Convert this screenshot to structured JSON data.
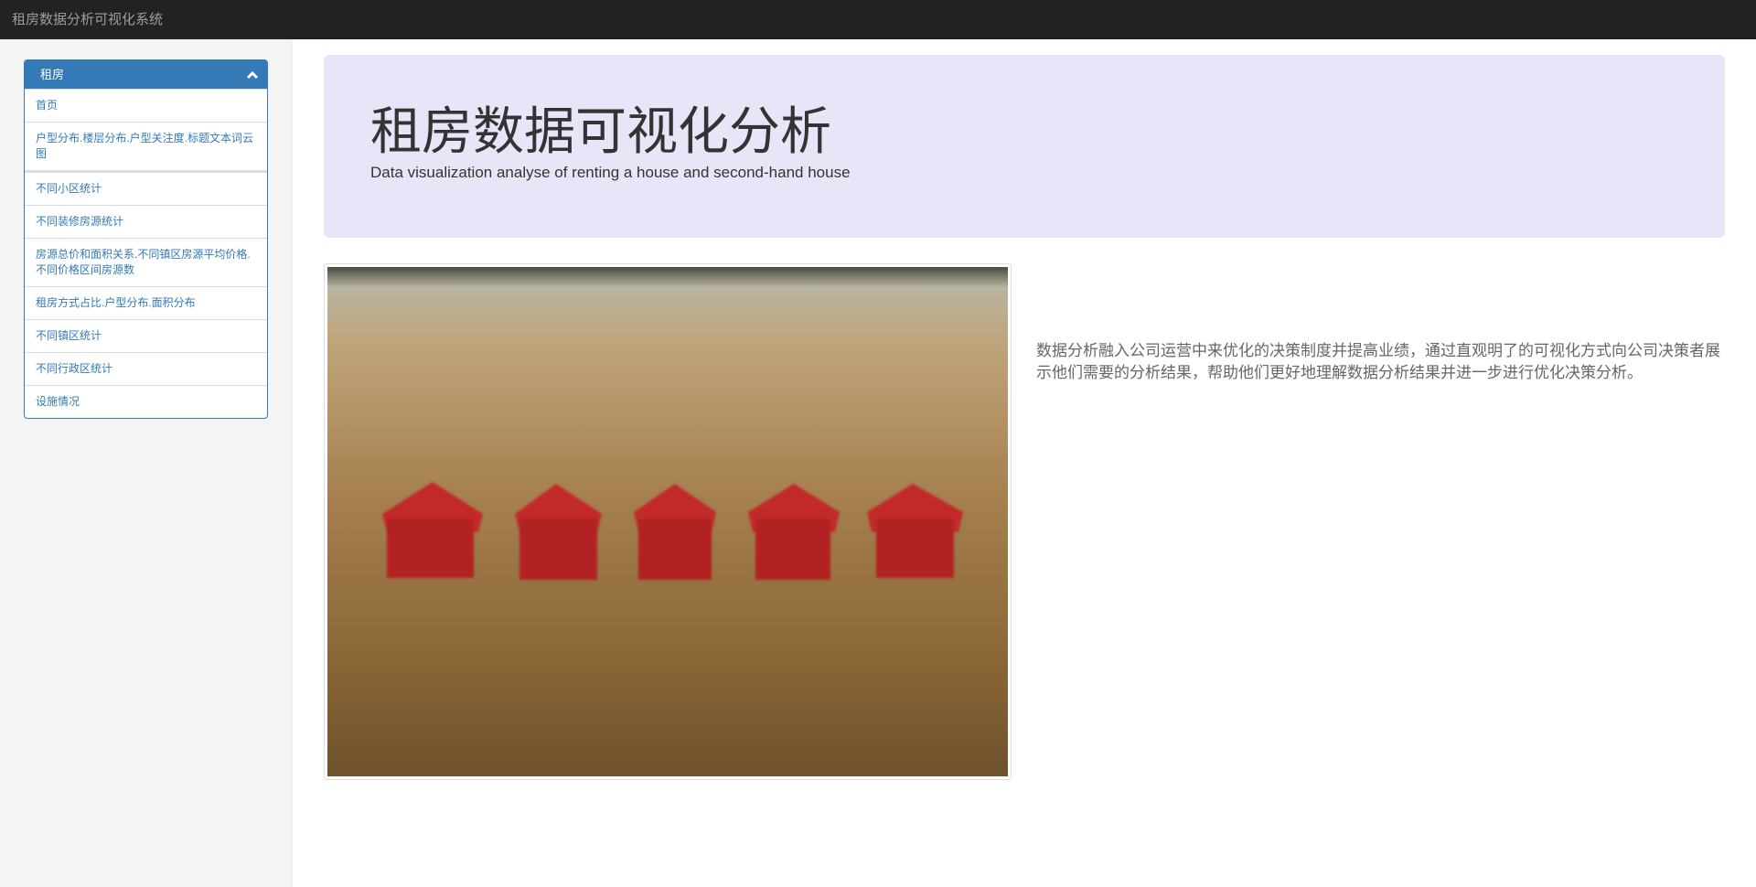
{
  "navbar": {
    "brand": "租房数据分析可视化系统"
  },
  "sidebar": {
    "panel_title": "租房",
    "items": [
      {
        "label": "首页"
      },
      {
        "label": "户型分布.楼层分布.户型关注度.标题文本词云图"
      },
      {
        "label": "不同小区统计"
      },
      {
        "label": "不同装修房源统计"
      },
      {
        "label": "房源总价和面积关系.不同镇区房源平均价格.不同价格区间房源数"
      },
      {
        "label": "租房方式占比.户型分布.面积分布"
      },
      {
        "label": "不同镇区统计"
      },
      {
        "label": "不同行政区统计"
      },
      {
        "label": "设施情况"
      }
    ]
  },
  "jumbotron": {
    "title": "租房数据可视化分析",
    "subtitle": "Data visualization analyse of renting a house and second-hand house"
  },
  "main": {
    "description": "数据分析融入公司运营中来优化的决策制度并提高业绩，通过直观明了的可视化方式向公司决策者展示他们需要的分析结果，帮助他们更好地理解数据分析结果并进一步进行优化决策分析。"
  },
  "colors": {
    "primary": "#337ab7",
    "navbar": "#222222",
    "jumbotron": "#e6e6f8"
  }
}
